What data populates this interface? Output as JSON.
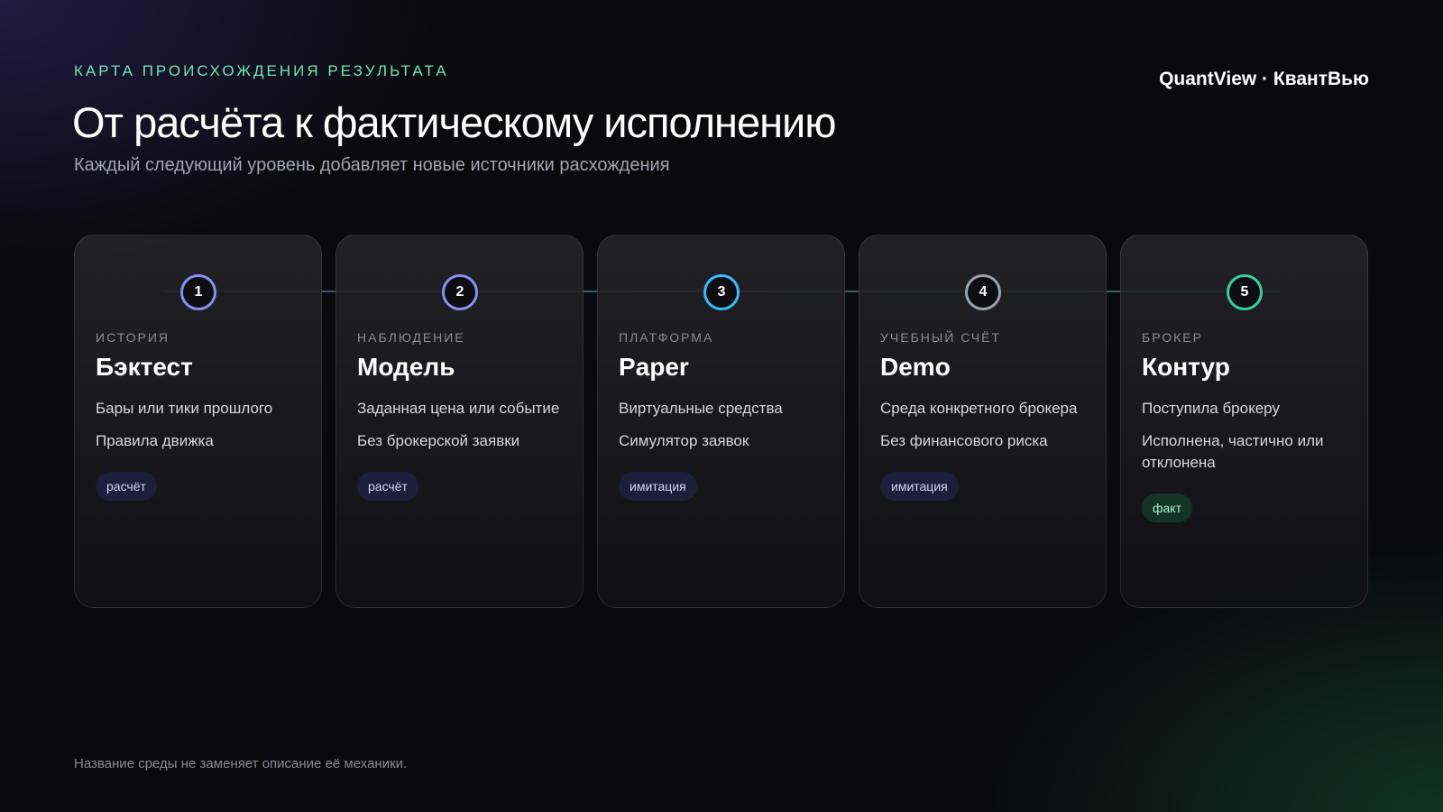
{
  "eyebrow": "КАРТА ПРОИСХОЖДЕНИЯ РЕЗУЛЬТАТА",
  "brand": "QuantView · КвантВью",
  "title": "От расчёта к фактическому исполнению",
  "subtitle": "Каждый следующий уровень добавляет новые источники расхождения",
  "colors": {
    "accent_green": "#6ee7b7",
    "tag_calc_bg": "#1e1e3a",
    "tag_fact_bg": "#123326"
  },
  "cards": [
    {
      "number": "1",
      "kicker": "ИСТОРИЯ",
      "name": "Бэктест",
      "lines": [
        "Бары или тики прошлого",
        "Правила движка"
      ],
      "tag": "расчёт",
      "tag_kind": "calc",
      "ring_color": "#8b8ff0"
    },
    {
      "number": "2",
      "kicker": "НАБЛЮДЕНИЕ",
      "name": "Модель",
      "lines": [
        "Заданная цена или событие",
        "Без брокерской заявки"
      ],
      "tag": "расчёт",
      "tag_kind": "calc",
      "ring_color": "#8b8ff0"
    },
    {
      "number": "3",
      "kicker": "ПЛАТФОРМА",
      "name": "Paper",
      "lines": [
        "Виртуальные средства",
        "Симулятор заявок"
      ],
      "tag": "имитация",
      "tag_kind": "sim",
      "ring_color": "#38bdf8"
    },
    {
      "number": "4",
      "kicker": "УЧЕБНЫЙ СЧЁТ",
      "name": "Demo",
      "lines": [
        "Среда конкретного брокера",
        "Без финансового риска"
      ],
      "tag": "имитация",
      "tag_kind": "sim",
      "ring_color": "#9ca3af"
    },
    {
      "number": "5",
      "kicker": "БРОКЕР",
      "name": "Контур",
      "lines": [
        "Поступила брокеру",
        "Исполнена, частично или отклонена"
      ],
      "tag": "факт",
      "tag_kind": "fact",
      "ring_color": "#34d399"
    }
  ],
  "footnote": "Название среды не заменяет описание её механики."
}
